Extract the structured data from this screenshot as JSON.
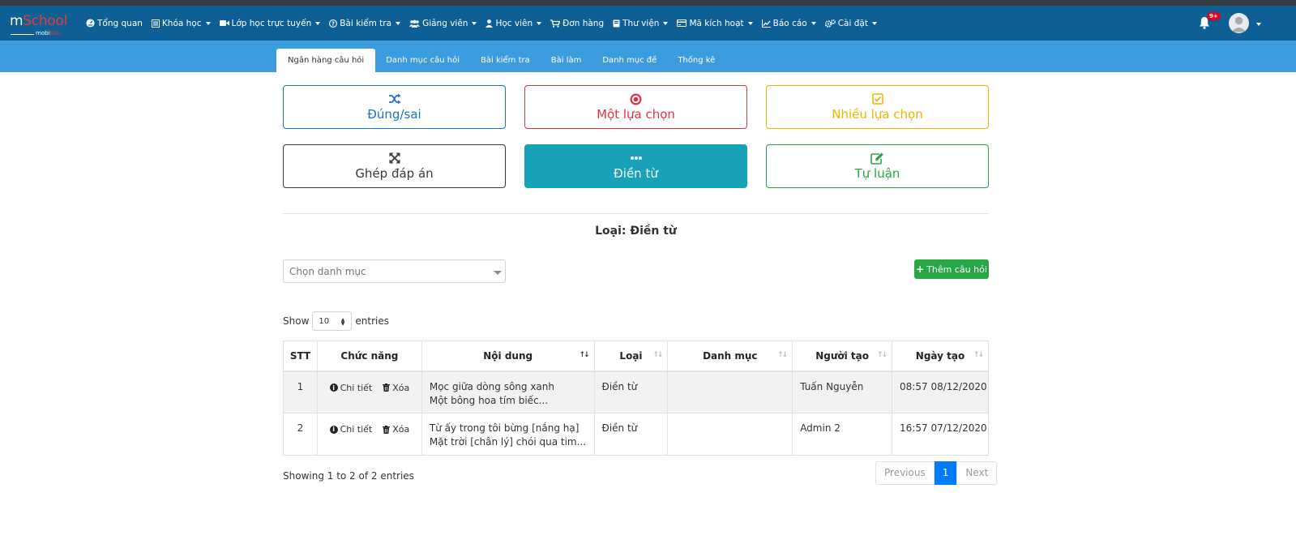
{
  "brand": {
    "main_a": "m",
    "main_b": "School",
    "sub_a": "mobi",
    "sub_b": "Edu"
  },
  "nav": {
    "items": [
      {
        "label": "Tổng quan",
        "icon": "dashboard-icon",
        "dropdown": false
      },
      {
        "label": "Khóa học",
        "icon": "book-icon",
        "dropdown": true
      },
      {
        "label": "Lớp học trực tuyến",
        "icon": "video-icon",
        "dropdown": true
      },
      {
        "label": "Bài kiểm tra",
        "icon": "question-icon",
        "dropdown": true
      },
      {
        "label": "Giảng viên",
        "icon": "users-icon",
        "dropdown": true
      },
      {
        "label": "Học viên",
        "icon": "user-icon",
        "dropdown": true
      },
      {
        "label": "Đơn hàng",
        "icon": "cart-icon",
        "dropdown": false
      },
      {
        "label": "Thư viện",
        "icon": "library-icon",
        "dropdown": true
      },
      {
        "label": "Mã kích hoạt",
        "icon": "card-icon",
        "dropdown": true
      },
      {
        "label": "Báo cáo",
        "icon": "chart-icon",
        "dropdown": true
      },
      {
        "label": "Cài đặt",
        "icon": "gears-icon",
        "dropdown": true
      }
    ],
    "notification_count": "9+"
  },
  "subnav": {
    "tabs": [
      "Ngân hàng câu hỏi",
      "Danh mục câu hỏi",
      "Bài kiểm tra",
      "Bài làm",
      "Danh mục đề",
      "Thống kê"
    ],
    "active_index": 0
  },
  "question_types": [
    {
      "label": "Đúng/sai",
      "icon": "shuffle-icon",
      "color": "#1a73c7"
    },
    {
      "label": "Một lựa chọn",
      "icon": "dot-circle-icon",
      "color": "#dc3545"
    },
    {
      "label": "Nhiều lựa chọn",
      "icon": "check-square-icon",
      "color": "#f0b400"
    },
    {
      "label": "Ghép đáp án",
      "icon": "arrows-icon",
      "color": "#343a40"
    },
    {
      "label": "Điền từ",
      "icon": "ellipsis-icon",
      "color": "#17a2b8"
    },
    {
      "label": "Tự luận",
      "icon": "edit-icon",
      "color": "#28a745"
    }
  ],
  "type_title": "Loại: Điền từ",
  "category_select": {
    "placeholder": "Chọn danh mục"
  },
  "add_button": "Thêm câu hỏi",
  "length": {
    "show": "Show",
    "value": "10",
    "entries": "entries"
  },
  "table": {
    "headers": [
      "STT",
      "Chức năng",
      "Nội dung",
      "Loại",
      "Danh mục",
      "Người tạo",
      "Ngày tạo"
    ],
    "action_detail": "Chi tiết",
    "action_delete": "Xóa",
    "rows": [
      {
        "stt": "1",
        "content_1": "Mọc giữa dòng sông xanh",
        "content_2": "Một bông hoa tím biếc...",
        "type": "Điền từ",
        "category": "",
        "creator": "Tuấn Nguyễn",
        "created": "08:57 08/12/2020"
      },
      {
        "stt": "2",
        "content_1": "Từ ấy trong tôi bừng [nắng hạ]",
        "content_2": "Mặt trời [chân lý] chói qua tim...",
        "type": "Điền từ",
        "category": "",
        "creator": "Admin 2",
        "created": "16:57 07/12/2020"
      }
    ]
  },
  "info": "Showing 1 to 2 of 2 entries",
  "pagination": {
    "previous": "Previous",
    "page": "1",
    "next": "Next"
  }
}
